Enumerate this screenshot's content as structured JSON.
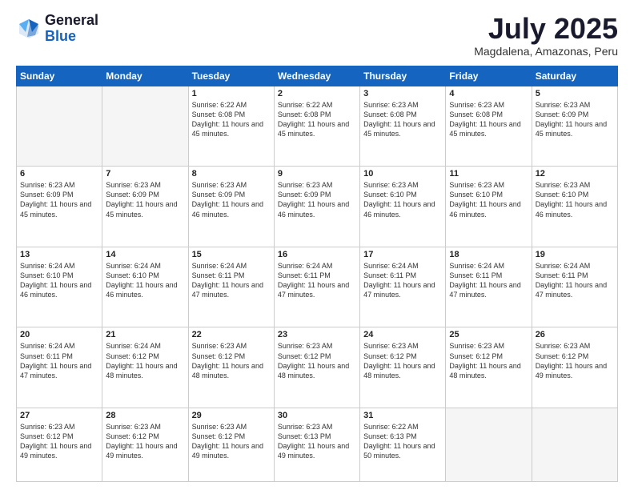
{
  "logo": {
    "general": "General",
    "blue": "Blue"
  },
  "header": {
    "month": "July 2025",
    "location": "Magdalena, Amazonas, Peru"
  },
  "weekdays": [
    "Sunday",
    "Monday",
    "Tuesday",
    "Wednesday",
    "Thursday",
    "Friday",
    "Saturday"
  ],
  "weeks": [
    [
      {
        "day": "",
        "empty": true
      },
      {
        "day": "",
        "empty": true
      },
      {
        "day": "1",
        "info": "Sunrise: 6:22 AM\nSunset: 6:08 PM\nDaylight: 11 hours and 45 minutes."
      },
      {
        "day": "2",
        "info": "Sunrise: 6:22 AM\nSunset: 6:08 PM\nDaylight: 11 hours and 45 minutes."
      },
      {
        "day": "3",
        "info": "Sunrise: 6:23 AM\nSunset: 6:08 PM\nDaylight: 11 hours and 45 minutes."
      },
      {
        "day": "4",
        "info": "Sunrise: 6:23 AM\nSunset: 6:08 PM\nDaylight: 11 hours and 45 minutes."
      },
      {
        "day": "5",
        "info": "Sunrise: 6:23 AM\nSunset: 6:09 PM\nDaylight: 11 hours and 45 minutes."
      }
    ],
    [
      {
        "day": "6",
        "info": "Sunrise: 6:23 AM\nSunset: 6:09 PM\nDaylight: 11 hours and 45 minutes."
      },
      {
        "day": "7",
        "info": "Sunrise: 6:23 AM\nSunset: 6:09 PM\nDaylight: 11 hours and 45 minutes."
      },
      {
        "day": "8",
        "info": "Sunrise: 6:23 AM\nSunset: 6:09 PM\nDaylight: 11 hours and 46 minutes."
      },
      {
        "day": "9",
        "info": "Sunrise: 6:23 AM\nSunset: 6:09 PM\nDaylight: 11 hours and 46 minutes."
      },
      {
        "day": "10",
        "info": "Sunrise: 6:23 AM\nSunset: 6:10 PM\nDaylight: 11 hours and 46 minutes."
      },
      {
        "day": "11",
        "info": "Sunrise: 6:23 AM\nSunset: 6:10 PM\nDaylight: 11 hours and 46 minutes."
      },
      {
        "day": "12",
        "info": "Sunrise: 6:23 AM\nSunset: 6:10 PM\nDaylight: 11 hours and 46 minutes."
      }
    ],
    [
      {
        "day": "13",
        "info": "Sunrise: 6:24 AM\nSunset: 6:10 PM\nDaylight: 11 hours and 46 minutes."
      },
      {
        "day": "14",
        "info": "Sunrise: 6:24 AM\nSunset: 6:10 PM\nDaylight: 11 hours and 46 minutes."
      },
      {
        "day": "15",
        "info": "Sunrise: 6:24 AM\nSunset: 6:11 PM\nDaylight: 11 hours and 47 minutes."
      },
      {
        "day": "16",
        "info": "Sunrise: 6:24 AM\nSunset: 6:11 PM\nDaylight: 11 hours and 47 minutes."
      },
      {
        "day": "17",
        "info": "Sunrise: 6:24 AM\nSunset: 6:11 PM\nDaylight: 11 hours and 47 minutes."
      },
      {
        "day": "18",
        "info": "Sunrise: 6:24 AM\nSunset: 6:11 PM\nDaylight: 11 hours and 47 minutes."
      },
      {
        "day": "19",
        "info": "Sunrise: 6:24 AM\nSunset: 6:11 PM\nDaylight: 11 hours and 47 minutes."
      }
    ],
    [
      {
        "day": "20",
        "info": "Sunrise: 6:24 AM\nSunset: 6:11 PM\nDaylight: 11 hours and 47 minutes."
      },
      {
        "day": "21",
        "info": "Sunrise: 6:24 AM\nSunset: 6:12 PM\nDaylight: 11 hours and 48 minutes."
      },
      {
        "day": "22",
        "info": "Sunrise: 6:23 AM\nSunset: 6:12 PM\nDaylight: 11 hours and 48 minutes."
      },
      {
        "day": "23",
        "info": "Sunrise: 6:23 AM\nSunset: 6:12 PM\nDaylight: 11 hours and 48 minutes."
      },
      {
        "day": "24",
        "info": "Sunrise: 6:23 AM\nSunset: 6:12 PM\nDaylight: 11 hours and 48 minutes."
      },
      {
        "day": "25",
        "info": "Sunrise: 6:23 AM\nSunset: 6:12 PM\nDaylight: 11 hours and 48 minutes."
      },
      {
        "day": "26",
        "info": "Sunrise: 6:23 AM\nSunset: 6:12 PM\nDaylight: 11 hours and 49 minutes."
      }
    ],
    [
      {
        "day": "27",
        "info": "Sunrise: 6:23 AM\nSunset: 6:12 PM\nDaylight: 11 hours and 49 minutes."
      },
      {
        "day": "28",
        "info": "Sunrise: 6:23 AM\nSunset: 6:12 PM\nDaylight: 11 hours and 49 minutes."
      },
      {
        "day": "29",
        "info": "Sunrise: 6:23 AM\nSunset: 6:12 PM\nDaylight: 11 hours and 49 minutes."
      },
      {
        "day": "30",
        "info": "Sunrise: 6:23 AM\nSunset: 6:13 PM\nDaylight: 11 hours and 49 minutes."
      },
      {
        "day": "31",
        "info": "Sunrise: 6:22 AM\nSunset: 6:13 PM\nDaylight: 11 hours and 50 minutes."
      },
      {
        "day": "",
        "empty": true
      },
      {
        "day": "",
        "empty": true
      }
    ]
  ]
}
